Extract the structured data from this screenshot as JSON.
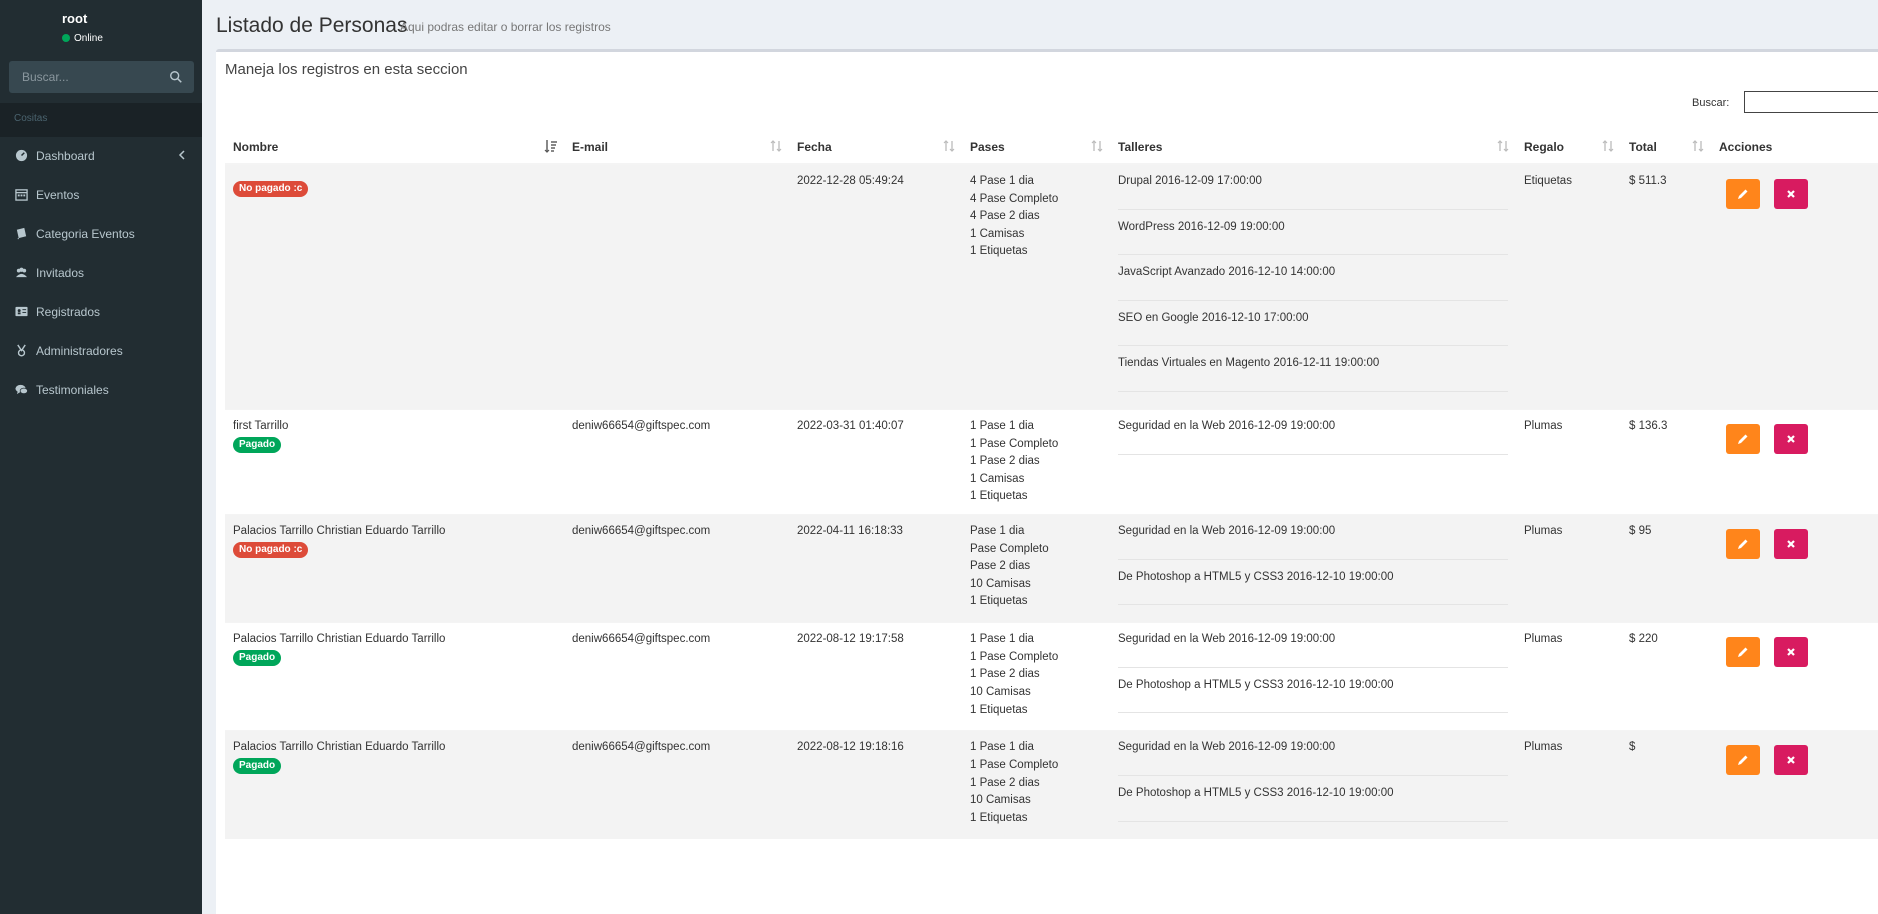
{
  "user": {
    "name": "root",
    "status": "Online"
  },
  "sidebar": {
    "search_placeholder": "Buscar...",
    "header": "Cositas",
    "items": [
      {
        "label": "Dashboard",
        "icon": "dashboard-icon"
      },
      {
        "label": "Eventos",
        "icon": "calendar-icon"
      },
      {
        "label": "Categoria Eventos",
        "icon": "book-icon"
      },
      {
        "label": "Invitados",
        "icon": "users-icon"
      },
      {
        "label": "Registrados",
        "icon": "id-card-icon"
      },
      {
        "label": "Administradores",
        "icon": "medal-icon"
      },
      {
        "label": "Testimoniales",
        "icon": "comments-icon"
      }
    ]
  },
  "page": {
    "title": "Listado de Personas",
    "subtitle": "Aqui podras editar o borrar los registros",
    "box_title": "Maneja los registros en esta seccion",
    "search_label": "Buscar:"
  },
  "table": {
    "columns": [
      "Nombre",
      "E-mail",
      "Fecha",
      "Pases",
      "Talleres",
      "Regalo",
      "Total",
      "Acciones"
    ],
    "rows": [
      {
        "nombre": "",
        "estado": "No pagado :c",
        "email": "",
        "fecha": "2022-12-28 05:49:24",
        "pases": [
          "4 Pase 1 dia",
          "4 Pase Completo",
          "4 Pase 2 dias",
          "1 Camisas",
          "1 Etiquetas"
        ],
        "talleres": [
          "Drupal 2016-12-09 17:00:00",
          "WordPress 2016-12-09 19:00:00",
          "JavaScript Avanzado 2016-12-10 14:00:00",
          "SEO en Google 2016-12-10 17:00:00",
          "Tiendas Virtuales en Magento 2016-12-11 19:00:00"
        ],
        "regalo": "Etiquetas",
        "total": "$ 511.3"
      },
      {
        "nombre": "first Tarrillo",
        "estado": "Pagado",
        "email": "deniw66654@giftspec.com",
        "fecha": "2022-03-31 01:40:07",
        "pases": [
          "1 Pase 1 dia",
          "1 Pase Completo",
          "1 Pase 2 dias",
          "1 Camisas",
          "1 Etiquetas"
        ],
        "talleres": [
          "Seguridad en la Web 2016-12-09 19:00:00"
        ],
        "regalo": "Plumas",
        "total": "$ 136.3"
      },
      {
        "nombre": "Palacios Tarrillo Christian Eduardo Tarrillo",
        "estado": "No pagado :c",
        "email": "deniw66654@giftspec.com",
        "fecha": "2022-04-11 16:18:33",
        "pases": [
          "Pase 1 dia",
          "Pase Completo",
          "Pase 2 dias",
          "10 Camisas",
          "1 Etiquetas"
        ],
        "talleres": [
          "Seguridad en la Web 2016-12-09 19:00:00",
          "De Photoshop a HTML5 y CSS3 2016-12-10 19:00:00"
        ],
        "regalo": "Plumas",
        "total": "$ 95"
      },
      {
        "nombre": "Palacios Tarrillo Christian Eduardo Tarrillo",
        "estado": "Pagado",
        "email": "deniw66654@giftspec.com",
        "fecha": "2022-08-12 19:17:58",
        "pases": [
          "1 Pase 1 dia",
          "1 Pase Completo",
          "1 Pase 2 dias",
          "10 Camisas",
          "1 Etiquetas"
        ],
        "talleres": [
          "Seguridad en la Web 2016-12-09 19:00:00",
          "De Photoshop a HTML5 y CSS3 2016-12-10 19:00:00"
        ],
        "regalo": "Plumas",
        "total": "$ 220"
      },
      {
        "nombre": "Palacios Tarrillo Christian Eduardo Tarrillo",
        "estado": "Pagado",
        "email": "deniw66654@giftspec.com",
        "fecha": "2022-08-12 19:18:16",
        "pases": [
          "1 Pase 1 dia",
          "1 Pase Completo",
          "1 Pase 2 dias",
          "10 Camisas",
          "1 Etiquetas"
        ],
        "talleres": [
          "Seguridad en la Web 2016-12-09 19:00:00",
          "De Photoshop a HTML5 y CSS3 2016-12-10 19:00:00"
        ],
        "regalo": "Plumas",
        "total": "$"
      }
    ]
  },
  "colors": {
    "sidebar_bg": "#222d32",
    "edit": "#ff851b",
    "delete": "#d81b60",
    "pagado": "#00a65a",
    "no_pagado": "#dd4b39"
  }
}
